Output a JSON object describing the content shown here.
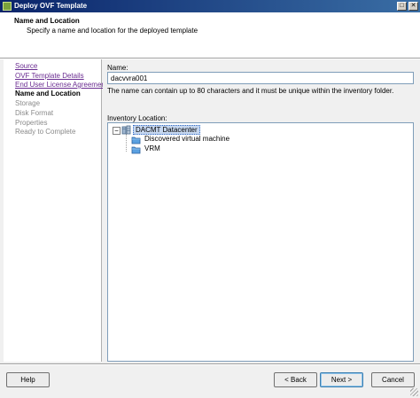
{
  "window": {
    "title": "Deploy OVF Template",
    "icon": "vsphere-app-icon",
    "maximize_glyph": "□",
    "close_glyph": "✕"
  },
  "header": {
    "title": "Name and Location",
    "subtitle": "Specify a name and location for the deployed template"
  },
  "steps": [
    {
      "label": "Source",
      "state": "link"
    },
    {
      "label": "OVF Template Details",
      "state": "link"
    },
    {
      "label": "End User License Agreement",
      "state": "link"
    },
    {
      "label": "Name and Location",
      "state": "current"
    },
    {
      "label": "Storage",
      "state": "disabled"
    },
    {
      "label": "Disk Format",
      "state": "disabled"
    },
    {
      "label": "Properties",
      "state": "disabled"
    },
    {
      "label": "Ready to Complete",
      "state": "disabled"
    }
  ],
  "form": {
    "name_label": "Name:",
    "name_value": "dacvvra001",
    "name_hint": "The name can contain up to 80 characters and it must be unique within the inventory folder.",
    "inventory_label": "Inventory Location:"
  },
  "tree": {
    "expander_glyph": "−",
    "root": {
      "label": "DACMT Datacenter",
      "icon": "datacenter-icon",
      "selected": true
    },
    "children": [
      {
        "label": "Discovered virtual machine",
        "icon": "folder-icon"
      },
      {
        "label": "VRM",
        "icon": "folder-icon"
      }
    ]
  },
  "buttons": {
    "help": "Help",
    "back": "< Back",
    "next": "Next >",
    "cancel": "Cancel"
  },
  "colors": {
    "link": "#6a2c91",
    "selection": "#c6d7ef",
    "titlebar": "#0a246a"
  }
}
